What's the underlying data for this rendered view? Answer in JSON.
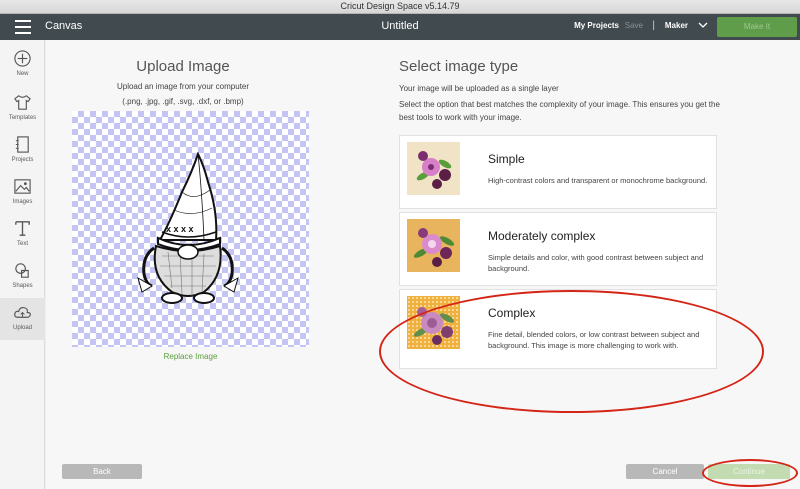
{
  "window": {
    "title": "Cricut Design Space  v5.14.79"
  },
  "topbar": {
    "canvas_label": "Canvas",
    "doc_title": "Untitled",
    "my_projects": "My Projects",
    "save": "Save",
    "separator": "|",
    "machine": "Maker",
    "make_button": "Make It"
  },
  "sidebar": {
    "items": [
      {
        "label": "New",
        "icon": "plus-icon"
      },
      {
        "label": "Templates",
        "icon": "shirt-icon"
      },
      {
        "label": "Projects",
        "icon": "notebook-icon"
      },
      {
        "label": "Images",
        "icon": "image-icon"
      },
      {
        "label": "Text",
        "icon": "text-icon"
      },
      {
        "label": "Shapes",
        "icon": "shapes-icon"
      },
      {
        "label": "Upload",
        "icon": "cloud-upload-icon",
        "active": true
      }
    ]
  },
  "upload": {
    "heading": "Upload Image",
    "line1": "Upload an image from your computer",
    "line2": "(.png, .jpg, .gif, .svg, .dxf, or .bmp)",
    "replace_link": "Replace Image"
  },
  "select": {
    "heading": "Select image type",
    "sub": "Your image will be uploaded as a single layer",
    "desc": "Select the option that best matches the complexity of your image. This ensures you get the best tools to work with your image.",
    "options": [
      {
        "title": "Simple",
        "desc": "High-contrast colors and transparent or monochrome background.",
        "thumb_bg": "#f0e3c6"
      },
      {
        "title": "Moderately complex",
        "desc": "Simple details and color, with good contrast between subject and background.",
        "thumb_bg": "#e8b45e"
      },
      {
        "title": "Complex",
        "desc": "Fine detail, blended colors, or low contrast between subject and background. This image is more challenging to work with.",
        "thumb_bg": "#f0b03e"
      }
    ]
  },
  "footer": {
    "back": "Back",
    "cancel": "Cancel",
    "continue": "Continue"
  },
  "colors": {
    "topbar": "#414a4f",
    "accent_green": "#5f9d4a",
    "annotation_red": "#d42516"
  }
}
